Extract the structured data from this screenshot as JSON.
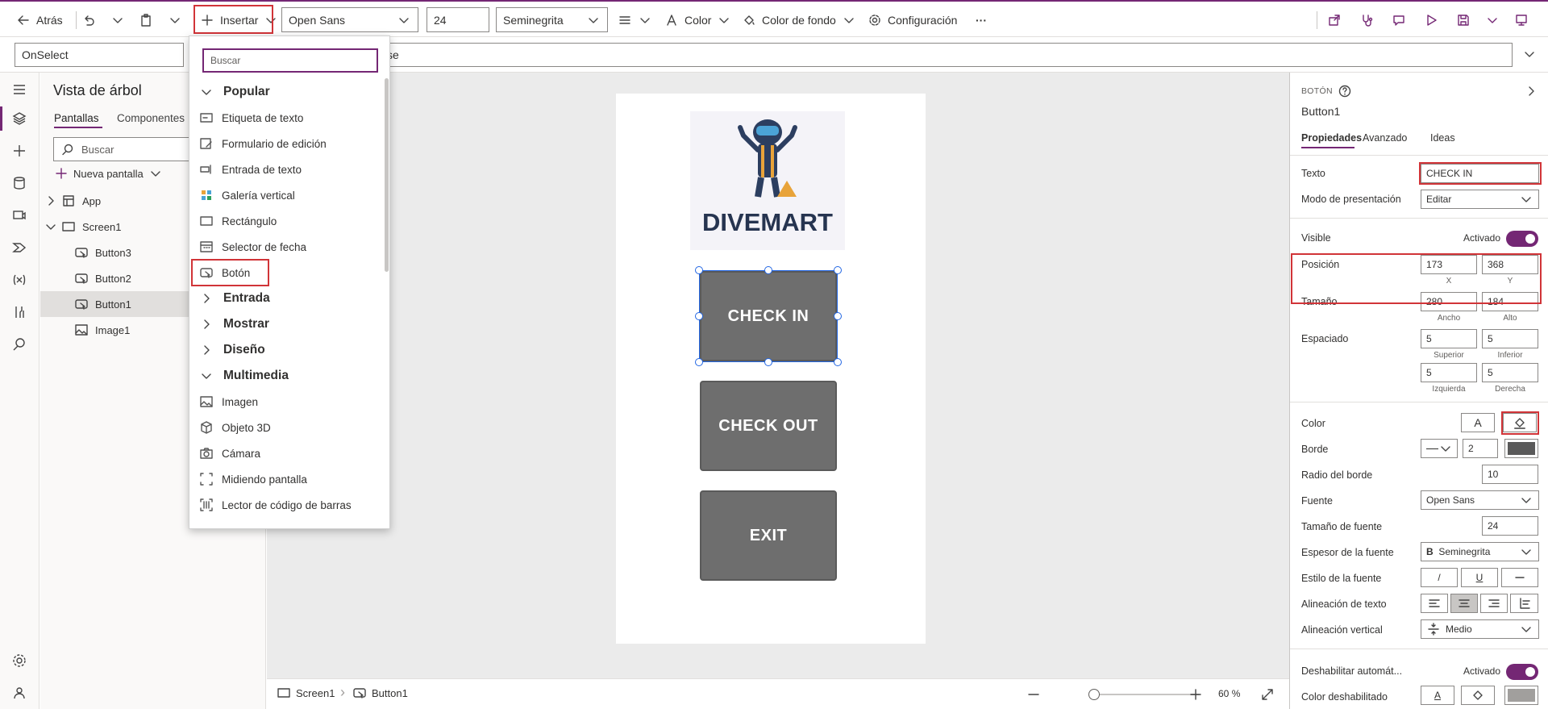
{
  "toolbar": {
    "back": "Atrás",
    "insert": "Insertar",
    "font": "Open Sans",
    "font_size": "24",
    "font_weight": "Seminegrita",
    "color": "Color",
    "bg_color": "Color de fondo",
    "settings": "Configuración",
    "more": "···"
  },
  "formula": {
    "property": "OnSelect",
    "value_fragment": "se"
  },
  "tree": {
    "title": "Vista de árbol",
    "tabs": [
      "Pantallas",
      "Componentes"
    ],
    "search_placeholder": "Buscar",
    "new_screen": "Nueva pantalla",
    "items": [
      "App",
      "Screen1",
      "Button3",
      "Button2",
      "Button1",
      "Image1"
    ]
  },
  "insert_menu": {
    "search_placeholder": "Buscar",
    "cat_popular": "Popular",
    "popular": [
      "Etiqueta de texto",
      "Formulario de edición",
      "Entrada de texto",
      "Galería vertical",
      "Rectángulo",
      "Selector de fecha",
      "Botón"
    ],
    "cat_entrada": "Entrada",
    "cat_mostrar": "Mostrar",
    "cat_diseno": "Diseño",
    "cat_multimedia": "Multimedia",
    "multimedia": [
      "Imagen",
      "Objeto 3D",
      "Cámara",
      "Midiendo pantalla",
      "Lector de código de barras"
    ]
  },
  "app": {
    "logo_text": "DIVEMART",
    "buttons": [
      "CHECK IN",
      "CHECK OUT",
      "EXIT"
    ]
  },
  "bottom": {
    "screen": "Screen1",
    "control": "Button1",
    "zoom": "60",
    "zoom_unit": "%"
  },
  "props": {
    "type": "BOTÓN",
    "name": "Button1",
    "tabs": [
      "Propiedades",
      "Avanzado",
      "Ideas"
    ],
    "texto_label": "Texto",
    "texto_value": "CHECK IN",
    "modo_label": "Modo de presentación",
    "modo_value": "Editar",
    "visible_label": "Visible",
    "visible_value": "Activado",
    "posicion_label": "Posición",
    "x": "173",
    "y": "368",
    "x_label": "X",
    "y_label": "Y",
    "tamano_label": "Tamaño",
    "ancho": "280",
    "alto": "184",
    "ancho_label": "Ancho",
    "alto_label": "Alto",
    "espaciado_label": "Espaciado",
    "sup": "5",
    "inf": "5",
    "izq": "5",
    "der": "5",
    "sup_label": "Superior",
    "inf_label": "Inferior",
    "izq_label": "Izquierda",
    "der_label": "Derecha",
    "color_label": "Color",
    "color_a": "A",
    "borde_label": "Borde",
    "borde_value": "2",
    "radio_label": "Radio del borde",
    "radio_value": "10",
    "fuente_label": "Fuente",
    "fuente_value": "Open Sans",
    "tam_fuente_label": "Tamaño de fuente",
    "tam_fuente_value": "24",
    "espesor_label": "Espesor de la fuente",
    "espesor_b": "B",
    "espesor_value": "Seminegrita",
    "estilo_label": "Estilo de la fuente",
    "estilo_i": "/",
    "estilo_u": "U",
    "alineacion_label": "Alineación de texto",
    "vert_label": "Alineación vertical",
    "vert_value": "Medio",
    "deshab_label": "Deshabilitar automát...",
    "deshab_value": "Activado",
    "color_desh_label": "Color deshabilitado",
    "color_desh_a": "A"
  },
  "colors": {
    "accent": "#742774",
    "button": "#6e6e6e",
    "highlight": "#d13438",
    "selection": "#2266e3"
  }
}
